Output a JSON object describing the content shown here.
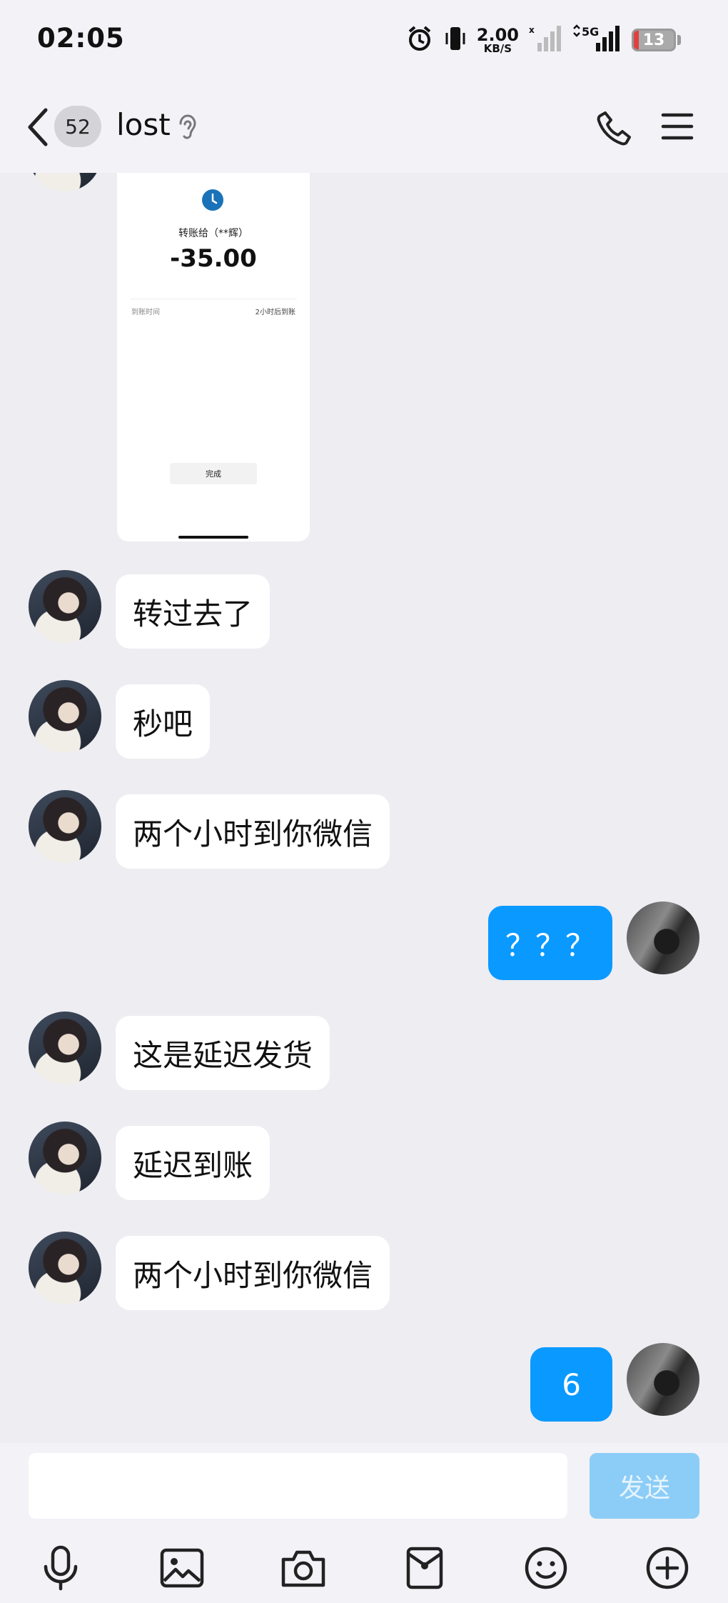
{
  "status_bar": {
    "time": "02:05",
    "net_speed_value": "2.00",
    "net_speed_unit": "KB/S",
    "network_type": "5G",
    "battery_percent": "13",
    "battery_level": 0.13,
    "icons": [
      "alarm-icon",
      "vibrate-icon",
      "sim1-signal-icon",
      "signal-5g-icon",
      "battery-icon"
    ]
  },
  "header": {
    "unread_count": "52",
    "contact_name": "lost",
    "icons": [
      "back-icon",
      "ear-icon",
      "phone-icon",
      "menu-icon"
    ]
  },
  "transfer_screenshot": {
    "recipient_line": "转账给（**辉）",
    "amount": "-35.00",
    "arrival_label": "到账时间",
    "arrival_value": "2小时后到账",
    "done_button": "完成"
  },
  "messages": [
    {
      "from": "contact",
      "text": "转过去了"
    },
    {
      "from": "contact",
      "text": "秒吧"
    },
    {
      "from": "contact",
      "text": "两个小时到你微信"
    },
    {
      "from": "me",
      "text": "？？？"
    },
    {
      "from": "contact",
      "text": "这是延迟发货"
    },
    {
      "from": "contact",
      "text": "延迟到账"
    },
    {
      "from": "contact",
      "text": "两个小时到你微信"
    },
    {
      "from": "me",
      "text": "6"
    }
  ],
  "composer": {
    "input_value": "",
    "send_label": "发送",
    "tools": [
      "microphone-icon",
      "image-icon",
      "camera-icon",
      "red-packet-icon",
      "emoji-icon",
      "plus-icon"
    ]
  },
  "colors": {
    "outgoing_bubble": "#0a99ff",
    "incoming_bubble": "#ffffff",
    "send_disabled": "#8ccdf7",
    "background": "#ededf2"
  }
}
